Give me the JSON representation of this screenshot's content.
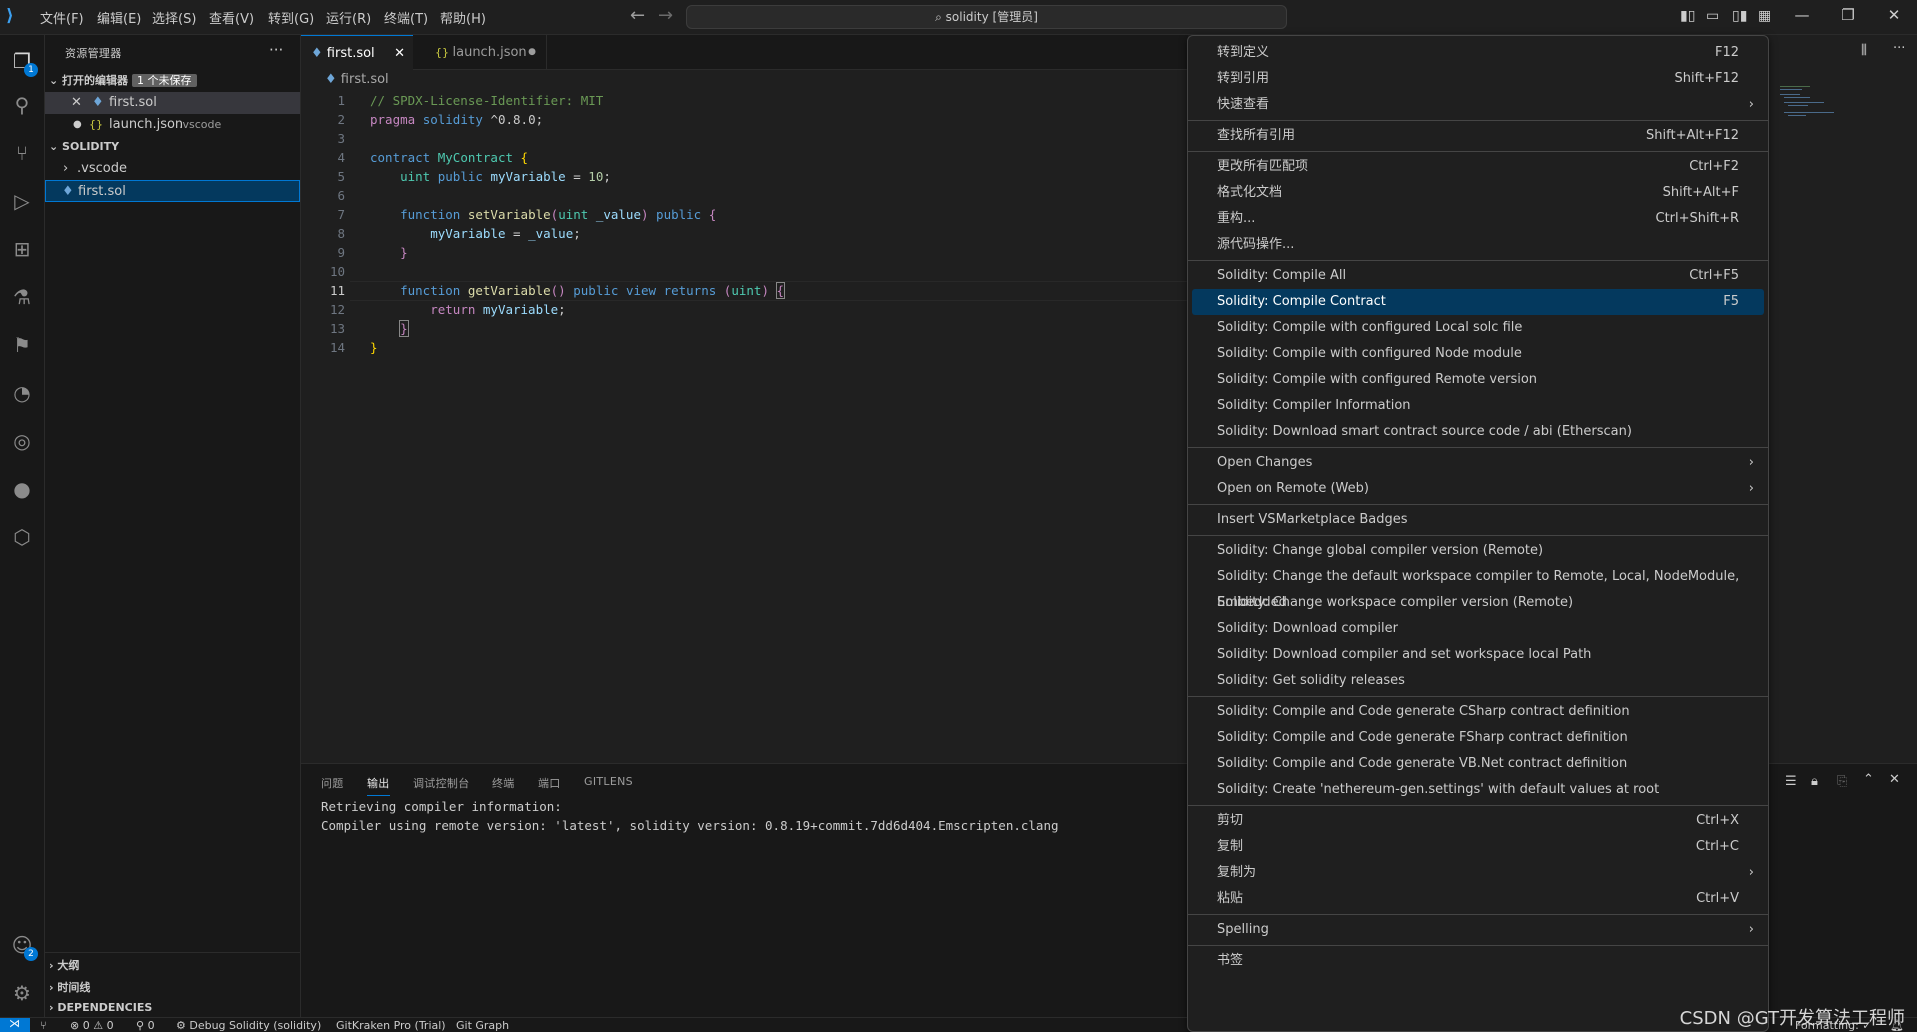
{
  "titlebar": {
    "menus": [
      "文件(F)",
      "编辑(E)",
      "选择(S)",
      "查看(V)",
      "转到(G)",
      "运行(R)",
      "终端(T)",
      "帮助(H)"
    ],
    "search_text": "solidity [管理员]"
  },
  "activity": {
    "explorer_badge": "1",
    "accounts_badge": "2"
  },
  "sidebar": {
    "title": "资源管理器",
    "open_editors_label": "打开的编辑器",
    "unsaved_badge": "1 个未保存",
    "open_editors": [
      {
        "name": "first.sol",
        "desc": ""
      },
      {
        "name": "launch.json",
        "desc": ".vscode"
      }
    ],
    "workspace_label": "SOLIDITY",
    "tree": [
      ".vscode",
      "first.sol"
    ],
    "outline_label": "大纲",
    "timeline_label": "时间线",
    "dependencies_label": "DEPENDENCIES"
  },
  "tabs": [
    {
      "label": "first.sol"
    },
    {
      "label": "launch.json"
    }
  ],
  "breadcrumb": "first.sol",
  "code": {
    "line_numbers": [
      "1",
      "2",
      "3",
      "4",
      "5",
      "6",
      "7",
      "8",
      "9",
      "10",
      "11",
      "12",
      "13",
      "14"
    ],
    "lines": [
      "// SPDX-License-Identifier: MIT",
      "pragma solidity ^0.8.0;",
      "",
      "contract MyContract {",
      "    uint public myVariable = 10;",
      "",
      "    function setVariable(uint _value) public {",
      "        myVariable = _value;",
      "    }",
      "",
      "    function getVariable() public view returns (uint) {",
      "        return myVariable;",
      "    }",
      "}"
    ]
  },
  "panel": {
    "tabs": [
      "问题",
      "输出",
      "调试控制台",
      "终端",
      "端口",
      "GITLENS"
    ],
    "output": [
      "Retrieving compiler information:",
      "Compiler using remote version: 'latest', solidity version: 0.8.19+commit.7dd6d404.Emscripten.clang"
    ]
  },
  "statusbar": {
    "errors": "0",
    "warnings": "0",
    "ports": "0",
    "debug": "Debug Solidity (solidity)",
    "gitkraken": "GitKraken Pro (Trial)",
    "gitgraph": "Git Graph",
    "formatting": "Formatting: ✓"
  },
  "context_menu": {
    "groups": [
      [
        {
          "label": "转到定义",
          "key": "F12"
        },
        {
          "label": "转到引用",
          "key": "Shift+F12"
        },
        {
          "label": "快速查看",
          "key": "",
          "submenu": true
        }
      ],
      [
        {
          "label": "查找所有引用",
          "key": "Shift+Alt+F12"
        }
      ],
      [
        {
          "label": "更改所有匹配项",
          "key": "Ctrl+F2"
        },
        {
          "label": "格式化文档",
          "key": "Shift+Alt+F"
        },
        {
          "label": "重构...",
          "key": "Ctrl+Shift+R"
        },
        {
          "label": "源代码操作...",
          "key": ""
        }
      ],
      [
        {
          "label": "Solidity: Compile All",
          "key": "Ctrl+F5"
        },
        {
          "label": "Solidity: Compile Contract",
          "key": "F5",
          "selected": true
        },
        {
          "label": "Solidity: Compile with configured Local solc file",
          "key": ""
        },
        {
          "label": "Solidity: Compile with configured Node module",
          "key": ""
        },
        {
          "label": "Solidity: Compile with configured Remote version",
          "key": ""
        },
        {
          "label": "Solidity: Compiler Information",
          "key": ""
        },
        {
          "label": "Solidity: Download smart contract source code / abi (Etherscan)",
          "key": ""
        }
      ],
      [
        {
          "label": "Open Changes",
          "key": "",
          "submenu": true
        },
        {
          "label": "Open on Remote (Web)",
          "key": "",
          "submenu": true
        }
      ],
      [
        {
          "label": "Insert VSMarketplace Badges",
          "key": ""
        }
      ],
      [
        {
          "label": "Solidity: Change global compiler version (Remote)",
          "key": ""
        },
        {
          "label": "Solidity: Change the default workspace compiler to Remote, Local, NodeModule, Embedded",
          "key": ""
        },
        {
          "label": "Solidity: Change workspace compiler version (Remote)",
          "key": ""
        },
        {
          "label": "Solidity: Download compiler",
          "key": ""
        },
        {
          "label": "Solidity: Download compiler and set workspace local Path",
          "key": ""
        },
        {
          "label": "Solidity: Get solidity releases",
          "key": ""
        }
      ],
      [
        {
          "label": "Solidity: Compile and Code generate CSharp contract definition",
          "key": ""
        },
        {
          "label": "Solidity: Compile and Code generate FSharp contract definition",
          "key": ""
        },
        {
          "label": "Solidity: Compile and Code generate VB.Net contract definition",
          "key": ""
        },
        {
          "label": "Solidity: Create 'nethereum-gen.settings' with default values at root",
          "key": ""
        }
      ],
      [
        {
          "label": "剪切",
          "key": "Ctrl+X"
        },
        {
          "label": "复制",
          "key": "Ctrl+C"
        },
        {
          "label": "复制为",
          "key": "",
          "submenu": true
        },
        {
          "label": "粘贴",
          "key": "Ctrl+V"
        }
      ],
      [
        {
          "label": "Spelling",
          "key": "",
          "submenu": true
        }
      ],
      [
        {
          "label": "书签",
          "key": ""
        }
      ]
    ]
  },
  "watermark": "CSDN @GT开发算法工程师",
  "colors": {
    "accent": "#0078d4",
    "selection": "#04395e",
    "background": "#1f1f1f"
  }
}
